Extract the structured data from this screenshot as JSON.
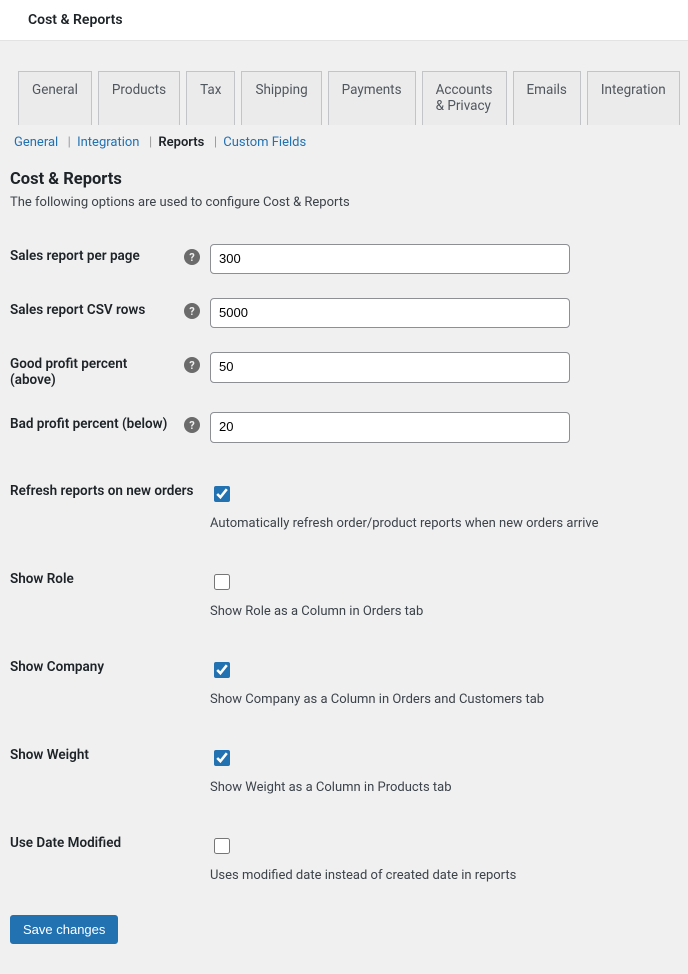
{
  "header": {
    "title": "Cost & Reports"
  },
  "tabs": {
    "general": "General",
    "products": "Products",
    "tax": "Tax",
    "shipping": "Shipping",
    "payments": "Payments",
    "accounts": "Accounts & Privacy",
    "emails": "Emails",
    "integration": "Integration"
  },
  "subsub": {
    "general": "General",
    "integration": "Integration",
    "reports": "Reports",
    "custom_fields": "Custom Fields"
  },
  "section": {
    "title": "Cost & Reports",
    "desc": "The following options are used to configure Cost & Reports"
  },
  "fields": {
    "per_page": {
      "label": "Sales report per page",
      "value": "300"
    },
    "csv_rows": {
      "label": "Sales report CSV rows",
      "value": "5000"
    },
    "good_profit": {
      "label": "Good profit percent (above)",
      "value": "50"
    },
    "bad_profit": {
      "label": "Bad profit percent (below)",
      "value": "20"
    },
    "refresh": {
      "label": "Refresh reports on new orders",
      "desc": "Automatically refresh order/product reports when new orders arrive",
      "checked": true
    },
    "show_role": {
      "label": "Show Role",
      "desc": "Show Role as a Column in Orders tab",
      "checked": false
    },
    "show_company": {
      "label": "Show Company",
      "desc": "Show Company as a Column in Orders and Customers tab",
      "checked": true
    },
    "show_weight": {
      "label": "Show Weight",
      "desc": "Show Weight as a Column in Products tab",
      "checked": true
    },
    "use_date_modified": {
      "label": "Use Date Modified",
      "desc": "Uses modified date instead of created date in reports",
      "checked": false
    }
  },
  "buttons": {
    "save": "Save changes"
  },
  "help_tip": "?"
}
